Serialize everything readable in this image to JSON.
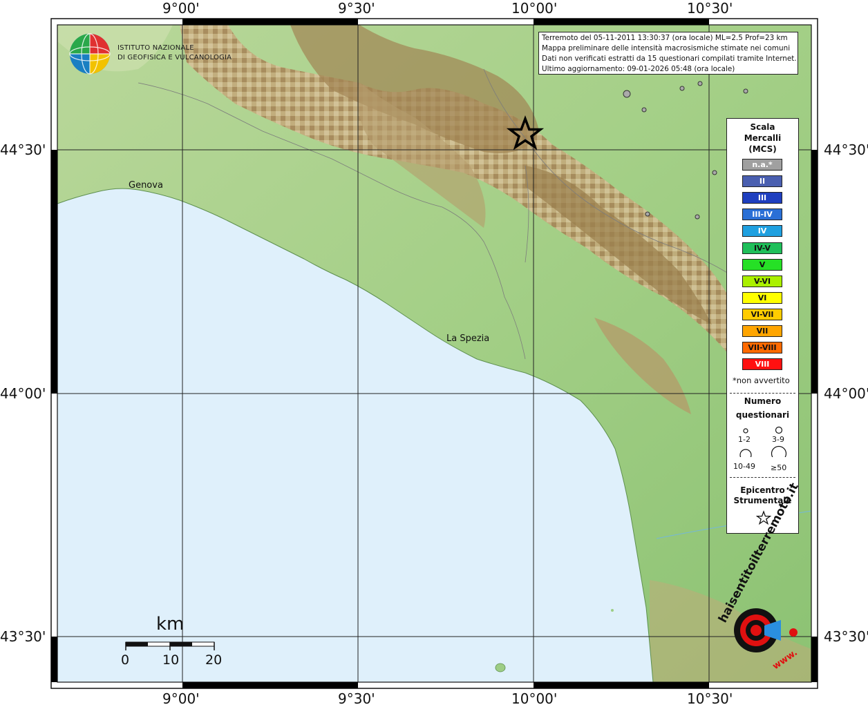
{
  "map": {
    "lon_ticks": [
      "9°00'",
      "9°30'",
      "10°00'",
      "10°30'"
    ],
    "lat_ticks": [
      "44°30'",
      "44°00'",
      "43°30'"
    ],
    "places": {
      "genova": "Genova",
      "la_spezia": "La Spezia"
    }
  },
  "info": {
    "line1": "Terremoto del 05-11-2011 13:30:37 (ora locale) ML=2.5 Prof=23 km",
    "line2": "Mappa preliminare delle intensità macrosismiche stimate nei comuni",
    "line3": "Dati non verificati estratti da 15 questionari compilati tramite Internet.",
    "line4": "Ultimo aggiornamento: 09-01-2026 05:48 (ora locale)"
  },
  "institute": {
    "line1": "ISTITUTO NAZIONALE",
    "line2": "DI GEOFISICA E VULCANOLOGIA"
  },
  "legend": {
    "title1": "Scala",
    "title2": "Mercalli",
    "title3": "(MCS)",
    "levels": [
      {
        "label": "n.a.*",
        "color": "#a0a0a0",
        "text": "#ffffff"
      },
      {
        "label": "II",
        "color": "#4a5fb0",
        "text": "#ffffff"
      },
      {
        "label": "III",
        "color": "#1f3fbf",
        "text": "#ffffff"
      },
      {
        "label": "III-IV",
        "color": "#2a6fd6",
        "text": "#ffffff"
      },
      {
        "label": "IV",
        "color": "#1fa0e0",
        "text": "#ffffff"
      },
      {
        "label": "IV-V",
        "color": "#1fbf5a",
        "text": "#111111"
      },
      {
        "label": "V",
        "color": "#26e026",
        "text": "#111111"
      },
      {
        "label": "V-VI",
        "color": "#aaf000",
        "text": "#111111"
      },
      {
        "label": "VI",
        "color": "#ffff00",
        "text": "#111111"
      },
      {
        "label": "VI-VII",
        "color": "#ffcc00",
        "text": "#111111"
      },
      {
        "label": "VII",
        "color": "#ffa500",
        "text": "#111111"
      },
      {
        "label": "VII-VIII",
        "color": "#ff6a00",
        "text": "#111111"
      },
      {
        "label": "VIII",
        "color": "#ff1010",
        "text": "#ffffff"
      }
    ],
    "not_felt_note": "*non avvertito",
    "count_title1": "Numero",
    "count_title2": "questionari",
    "counts": [
      "1-2",
      "3-9",
      "10-49",
      "≥50"
    ],
    "epicenter_title1": "Epicentro",
    "epicenter_title2": "Strumentale"
  },
  "scale_bar": {
    "unit": "km",
    "ticks": [
      "0",
      "10",
      "20"
    ]
  },
  "brand": {
    "text": "haisentitoilterremoto.it",
    "url": "www."
  },
  "colors": {
    "sea": "#dff0fb",
    "land": "#9dcd85",
    "relief": "#b08a5e",
    "star": "#000000"
  }
}
